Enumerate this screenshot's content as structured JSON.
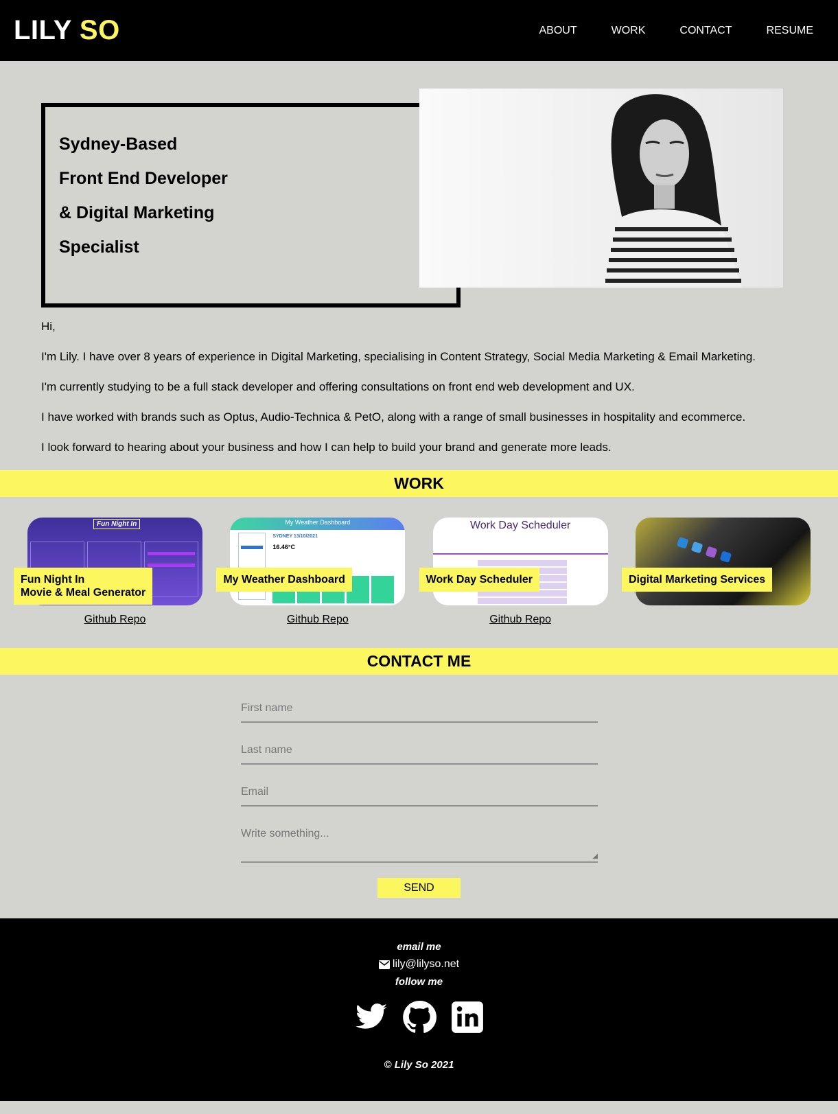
{
  "header": {
    "logo_main": "LILY",
    "logo_accent": "SO",
    "nav": [
      "ABOUT",
      "WORK",
      "CONTACT",
      "RESUME"
    ]
  },
  "hero": {
    "lines": [
      "Sydney-Based",
      "Front End Developer",
      "& Digital Marketing",
      "Specialist"
    ]
  },
  "about": {
    "paragraphs": [
      "Hi,",
      "I'm Lily. I have over 8 years of experience in Digital Marketing, specialising in Content Strategy, Social Media Marketing & Email Marketing.",
      "I'm currently studying to be a full stack developer and offering consultations on front end web development and UX.",
      "I have worked with brands such as Optus, Audio-Technica & PetO, along with a range of small businesses in hospitality and ecommerce.",
      "I look forward to hearing about your business and how I can help to build your brand and generate more leads."
    ]
  },
  "work": {
    "title": "WORK",
    "items": [
      {
        "tag_line1": "Fun Night In",
        "tag_line2": "Movie & Meal Generator",
        "link": "Github Repo",
        "thumb_title": "Fun Night In"
      },
      {
        "tag_line1": "My Weather Dashboard",
        "tag_line2": "",
        "link": "Github Repo",
        "thumb_title": "My Weather Dashboard",
        "thumb_city": "SYDNEY 13/10/2021",
        "thumb_temp": "16.46°C"
      },
      {
        "tag_line1": "Work Day Scheduler",
        "tag_line2": "",
        "link": "Github Repo",
        "thumb_title": "Work Day Scheduler"
      },
      {
        "tag_line1": "Digital Marketing Services",
        "tag_line2": "",
        "link": "",
        "thumb_title": ""
      }
    ]
  },
  "contact": {
    "title": "CONTACT ME",
    "first_name": "First name",
    "last_name": "Last name",
    "email": "Email",
    "message": "Write something...",
    "send": "SEND"
  },
  "footer": {
    "email_label": "email me",
    "email": "lily@lilyso.net",
    "follow_label": "follow me",
    "copyright": "© Lily So 2021"
  },
  "colors": {
    "accent": "#fcf75e",
    "background": "#d3d3cf",
    "dark": "#000000"
  }
}
